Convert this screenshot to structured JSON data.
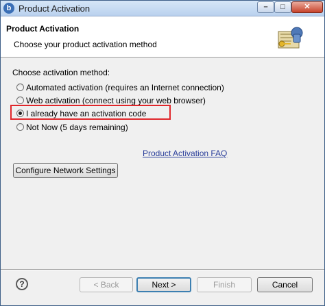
{
  "window": {
    "title": "Product Activation",
    "app_icon_letter": "b",
    "controls": {
      "minimize": "–",
      "maximize": "□",
      "close": "✕"
    }
  },
  "banner": {
    "title": "Product Activation",
    "subtitle": "Choose your product activation method",
    "icon": "key-certificate-icon"
  },
  "method": {
    "label": "Choose activation method:",
    "options": [
      {
        "label": "Automated activation (requires an Internet connection)",
        "selected": false
      },
      {
        "label": "Web activation (connect using your web browser)",
        "selected": false
      },
      {
        "label": "I already have an activation code",
        "selected": true
      },
      {
        "label": "Not Now (5 days remaining)",
        "selected": false
      }
    ]
  },
  "faq_link": "Product Activation FAQ",
  "configure_button": "Configure Network Settings",
  "footer": {
    "help_icon": "?",
    "back": "< Back",
    "next": "Next >",
    "finish": "Finish",
    "cancel": "Cancel"
  },
  "colors": {
    "highlight": "#e0262a",
    "link": "#2b3f9b"
  }
}
